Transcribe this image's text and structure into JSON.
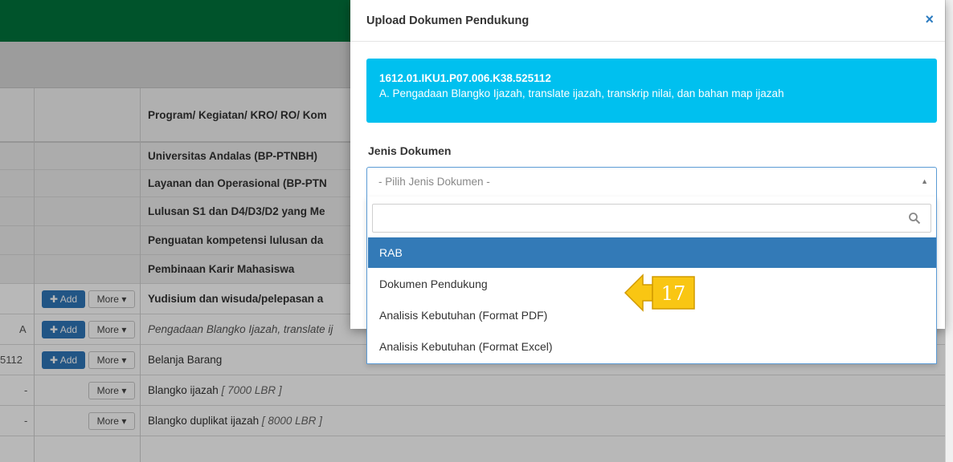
{
  "header_column": "Program/ Kegiatan/ KRO/ RO/ Kom",
  "rows": [
    {
      "text": "Universitas Andalas (BP-PTNBH)",
      "style": "bold"
    },
    {
      "text": "Layanan dan Operasional (BP-PTN",
      "style": "bold"
    },
    {
      "text": "Lulusan S1 dan D4/D3/D2 yang Me",
      "style": "bold"
    },
    {
      "text": "Penguatan kompetensi lulusan da",
      "style": "bold"
    },
    {
      "text": "Pembinaan Karir Mahasiswa",
      "style": "bold"
    },
    {
      "text": "Yudisium dan wisuda/pelepasan a",
      "style": "bold"
    },
    {
      "text": "Pengadaan Blangko Ijazah, translate ij",
      "style": "italic",
      "code": "A"
    },
    {
      "text": "Belanja Barang",
      "style": "normal",
      "code": "5112"
    },
    {
      "text": "Blangko ijazah",
      "note": "[ 7000 LBR ]",
      "style": "normal",
      "code": "-"
    },
    {
      "text": "Blangko duplikat ijazah",
      "note": "[ 8000 LBR ]",
      "style": "normal",
      "code": "-"
    }
  ],
  "buttons": {
    "add": "Add",
    "more": "More"
  },
  "modal": {
    "title": "Upload Dokumen Pendukung",
    "close": "×",
    "info_code": "1612.01.IKU1.P07.006.K38.525112",
    "info_desc": "A. Pengadaan Blangko Ijazah, translate ijazah, transkrip nilai, dan bahan map ijazah",
    "field_label": "Jenis Dokumen",
    "select_placeholder": "- Pilih Jenis Dokumen -"
  },
  "dropdown": {
    "search_placeholder": "",
    "options": [
      {
        "label": "RAB",
        "selected": true
      },
      {
        "label": "Dokumen Pendukung",
        "selected": false
      },
      {
        "label": "Analisis Kebutuhan (Format PDF)",
        "selected": false
      },
      {
        "label": "Analisis Kebutuhan (Format Excel)",
        "selected": false
      }
    ]
  },
  "callout": {
    "number": "17",
    "color": "#f9c613"
  },
  "colors": {
    "topbar": "#00733c",
    "info_box": "#00c0ef",
    "selected_option": "#337ab7",
    "add_button": "#2f76b9"
  }
}
